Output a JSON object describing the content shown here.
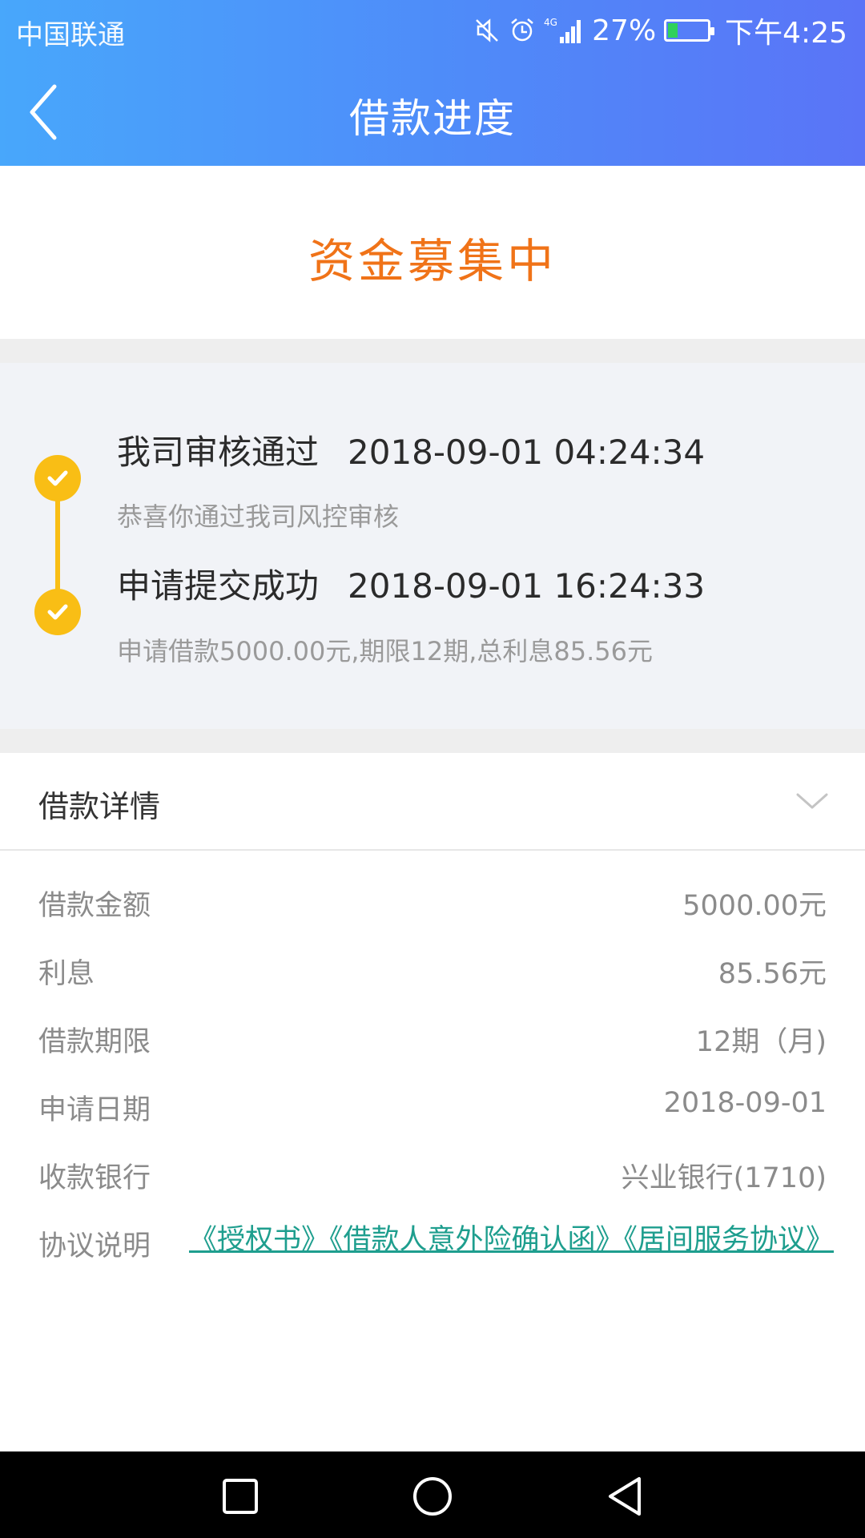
{
  "status_bar": {
    "carrier": "中国联通",
    "network": "4G",
    "battery": "27%",
    "battery_level": 0.27,
    "time": "下午4:25",
    "icons": [
      "mute-icon",
      "alarm-icon",
      "signal-icon",
      "battery-icon"
    ]
  },
  "header": {
    "title": "借款进度",
    "back_icon": "chevron-left-icon"
  },
  "status": {
    "text": "资金募集中",
    "color": "#f07318"
  },
  "timeline": [
    {
      "title": "我司审核通过",
      "time": "2018-09-01 04:24:34",
      "description": "恭喜你通过我司风控审核"
    },
    {
      "title": "申请提交成功",
      "time": "2018-09-01 16:24:33",
      "description": "申请借款5000.00元,期限12期,总利息85.56元"
    }
  ],
  "details": {
    "title": "借款详情",
    "rows": [
      {
        "label": "借款金额",
        "value": "5000.00元"
      },
      {
        "label": "利息",
        "value": "85.56元"
      },
      {
        "label": "借款期限",
        "value": "12期（月)"
      },
      {
        "label": "申请日期",
        "value": "2018-09-01"
      },
      {
        "label": "收款银行",
        "value": "兴业银行(1710)"
      }
    ],
    "agreement_label": "协议说明",
    "agreement_links": "《授权书》《借款人意外险确认函》《居间服务协议》"
  },
  "colors": {
    "header_gradient_start": "#48a7fb",
    "header_gradient_end": "#5a74f7",
    "accent_orange": "#f07318",
    "timeline_yellow": "#f9be15",
    "link_teal": "#1e9e8e"
  },
  "navbar": {
    "icons": [
      "recent-apps-icon",
      "home-icon",
      "back-triangle-icon"
    ]
  }
}
